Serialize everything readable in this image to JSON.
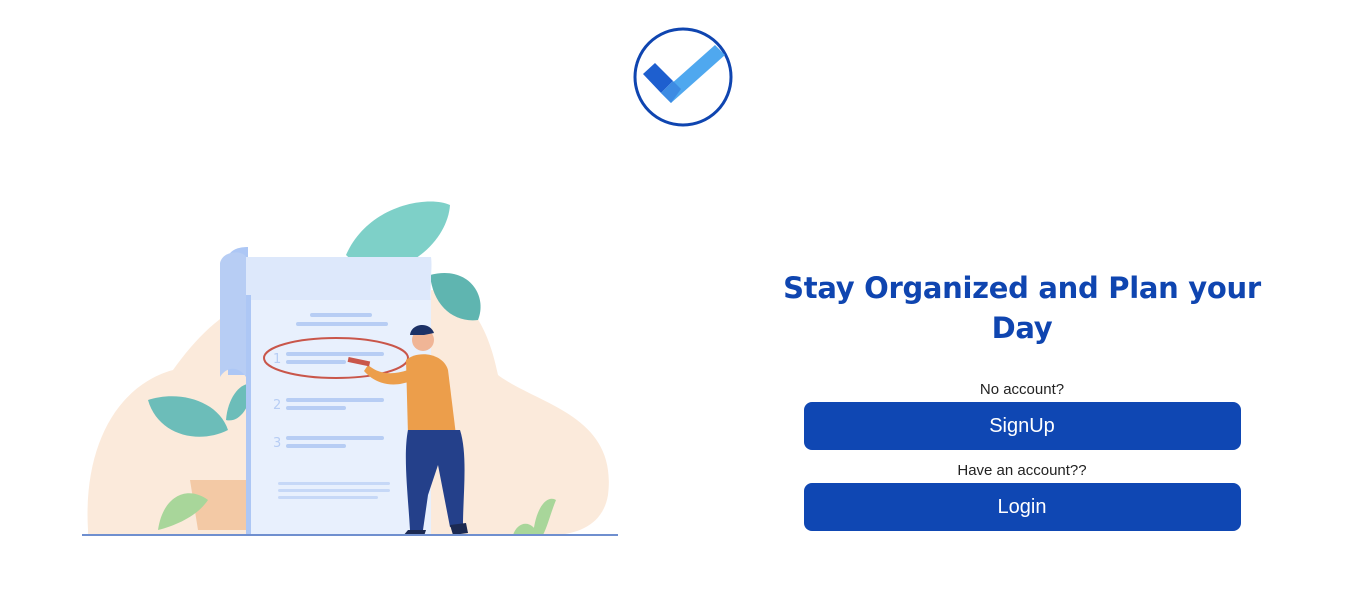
{
  "logo": {
    "icon": "checkmark-icon",
    "colors": {
      "ring": "#0f45b0",
      "check_light": "#4fa8ef",
      "check_dark": "#1e5fcf"
    }
  },
  "illustration": {
    "icon": "person-checklist-illustration"
  },
  "hero": {
    "headline": "Stay Organized and Plan your Day"
  },
  "signup": {
    "prompt": "No account?",
    "button_label": "SignUp"
  },
  "login": {
    "prompt": "Have an account??",
    "button_label": "Login"
  },
  "theme": {
    "primary": "#0f47b3"
  }
}
